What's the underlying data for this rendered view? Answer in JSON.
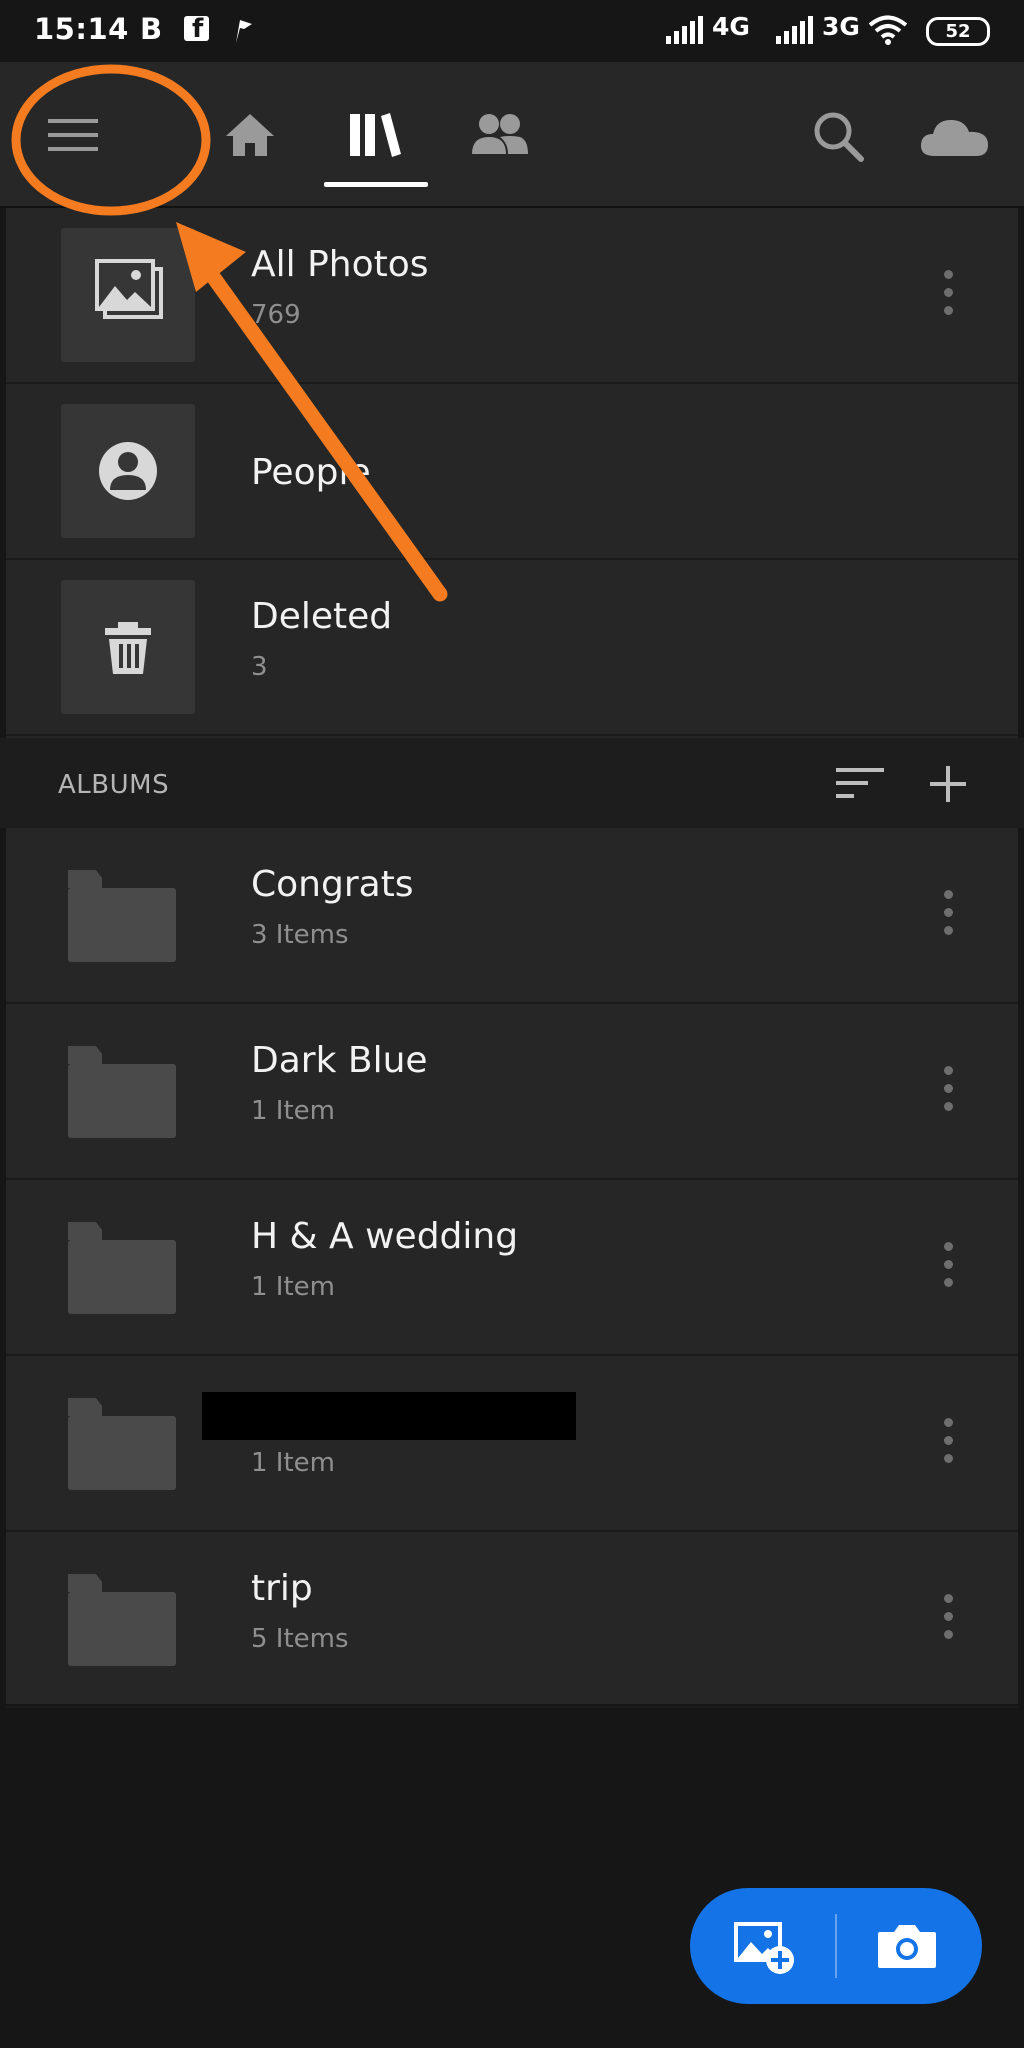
{
  "status_bar": {
    "time": "15:14",
    "app_icons": [
      "B",
      "f",
      "flag-icon"
    ],
    "network1": "4G",
    "network2": "3G",
    "battery": "52"
  },
  "nav": {
    "tabs": [
      "menu-icon",
      "home-icon",
      "library-icon",
      "people-tab-icon",
      "search-icon",
      "cloud-icon"
    ],
    "active_tab": "library"
  },
  "library": {
    "all_photos": {
      "label": "All Photos",
      "count": "769"
    },
    "people": {
      "label": "People"
    },
    "deleted": {
      "label": "Deleted",
      "count": "3"
    }
  },
  "albums": {
    "header": "ALBUMS",
    "items": [
      {
        "name": "Congrats",
        "count": "3 Items"
      },
      {
        "name": "Dark Blue",
        "count": "1 Item"
      },
      {
        "name": "H & A wedding",
        "count": "1 Item"
      },
      {
        "name": "",
        "count": "1 Item"
      },
      {
        "name": "trip",
        "count": "5 Items"
      }
    ]
  },
  "colors": {
    "background": "#161616",
    "row": "#262626",
    "accent": "#1473e6",
    "annotation": "#f47b20"
  }
}
